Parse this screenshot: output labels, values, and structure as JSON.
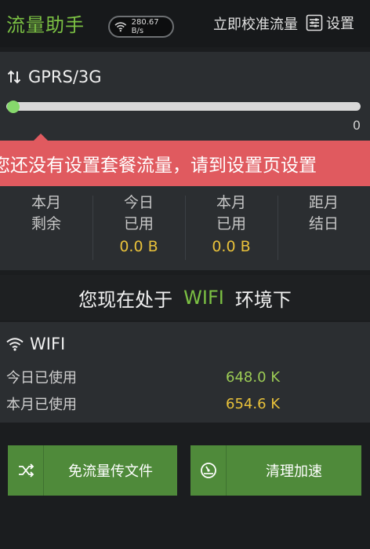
{
  "header": {
    "app_title": "流量助手",
    "speed": "280.67 B/s",
    "calibrate_label": "立即校准流量",
    "settings_label": "设置"
  },
  "gprs": {
    "title": "GPRS/3G",
    "progress_end_label": "0",
    "progress_fraction": 0.0,
    "warning": "您还没有设置套餐流量，请到设置页设置"
  },
  "stats": [
    {
      "label_line1": "本月",
      "label_line2": "剩余",
      "value": ""
    },
    {
      "label_line1": "今日",
      "label_line2": "已用",
      "value": "0.0 B"
    },
    {
      "label_line1": "本月",
      "label_line2": "已用",
      "value": "0.0 B"
    },
    {
      "label_line1": "距月",
      "label_line2": "结日",
      "value": ""
    }
  ],
  "environment": {
    "prefix": "您现在处于",
    "network": "WIFI",
    "suffix": "环境下"
  },
  "wifi": {
    "title": "WIFI",
    "today_label": "今日已使用",
    "today_value": "648.0 K",
    "month_label": "本月已使用",
    "month_value": "654.6 K"
  },
  "actions": {
    "transfer_label": "免流量传文件",
    "clean_label": "清理加速"
  },
  "icons": {
    "header_wifi": "wifi-icon",
    "settings": "settings-list-icon",
    "gprs": "updown-arrows-icon",
    "wifi": "wifi-icon",
    "transfer": "shuffle-icon",
    "clean": "speedometer-icon"
  },
  "colors": {
    "accent_green": "#7bc043",
    "warning_red": "#e05a5f",
    "value_yellow": "#e8c13a",
    "button_green": "#4f8a3a"
  }
}
